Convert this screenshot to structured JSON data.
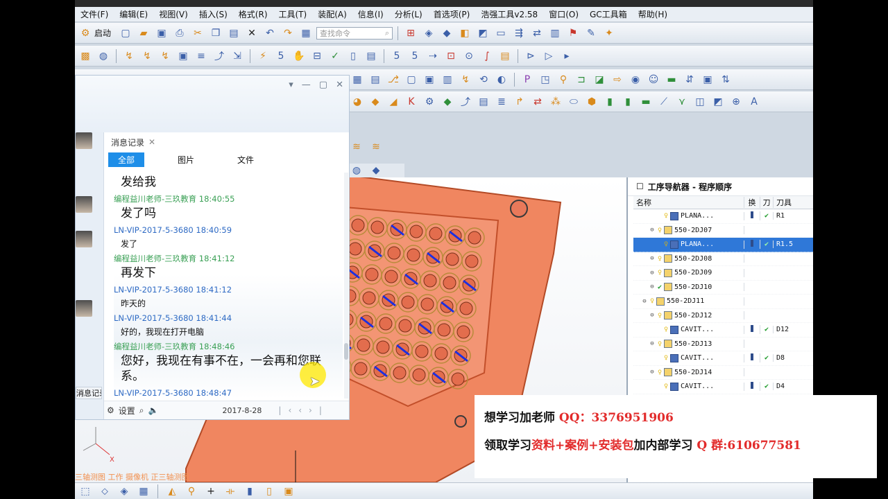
{
  "app": {
    "menu": [
      "文件(F)",
      "编辑(E)",
      "视图(V)",
      "插入(S)",
      "格式(R)",
      "工具(T)",
      "装配(A)",
      "信息(I)",
      "分析(L)",
      "首选项(P)",
      "浩强工具v2.58",
      "窗口(O)",
      "GC工具箱",
      "帮助(H)"
    ],
    "start_label": "启动",
    "search_placeholder": "查找命令",
    "bottom_hints": "三轴测图 工作 摄像机 正三轴测图"
  },
  "chat": {
    "history_tab": "消息记录",
    "tabs": [
      "全部",
      "图片",
      "文件"
    ],
    "side_label": "消息记录",
    "messages": [
      {
        "type": "big",
        "text": "发给我"
      },
      {
        "type": "meta",
        "who": "teacher",
        "text": "编程益川老师-三玖教育 18:40:55"
      },
      {
        "type": "big",
        "text": "发了吗"
      },
      {
        "type": "meta",
        "who": "student",
        "text": "LN-VIP-2017-5-3680 18:40:59"
      },
      {
        "type": "small",
        "text": "发了"
      },
      {
        "type": "meta",
        "who": "teacher",
        "text": "编程益川老师-三玖教育 18:41:12"
      },
      {
        "type": "big",
        "text": "再发下"
      },
      {
        "type": "meta",
        "who": "student",
        "text": "LN-VIP-2017-5-3680 18:41:12"
      },
      {
        "type": "small",
        "text": "昨天的"
      },
      {
        "type": "meta",
        "who": "student",
        "text": "LN-VIP-2017-5-3680 18:41:44"
      },
      {
        "type": "small",
        "text": "好的，我现在打开电脑"
      },
      {
        "type": "meta",
        "who": "teacher",
        "text": "编程益川老师-三玖教育 18:48:46"
      },
      {
        "type": "big",
        "text": "您好，我现在有事不在，一会再和您联系。"
      },
      {
        "type": "meta",
        "who": "student",
        "text": "LN-VIP-2017-5-3680 18:48:47"
      }
    ],
    "footer": {
      "settings": "设置",
      "date": "2017-8-28"
    }
  },
  "navigator": {
    "title": "工序导航器 - 程序顺序",
    "columns": [
      "名称",
      "换",
      "刀",
      "刀具"
    ],
    "rows": [
      {
        "indent": 4,
        "name": "PLANA...",
        "kind": "op",
        "status": "key",
        "check": true,
        "tool": "R1",
        "selected": false
      },
      {
        "indent": 2,
        "name": "550-2DJ07",
        "kind": "group",
        "status": "key",
        "check": false,
        "tool": "",
        "selected": false
      },
      {
        "indent": 4,
        "name": "PLANA...",
        "kind": "op",
        "status": "key",
        "check": true,
        "tool": "R1.5",
        "selected": true
      },
      {
        "indent": 2,
        "name": "550-2DJ08",
        "kind": "group",
        "status": "key",
        "check": false,
        "tool": "",
        "selected": false
      },
      {
        "indent": 2,
        "name": "550-2DJ09",
        "kind": "group",
        "status": "key",
        "check": false,
        "tool": "",
        "selected": false
      },
      {
        "indent": 2,
        "name": "550-2DJ10",
        "kind": "group",
        "status": "check",
        "check": false,
        "tool": "",
        "selected": false
      },
      {
        "indent": 1,
        "name": "550-2DJ11",
        "kind": "group",
        "status": "key",
        "check": false,
        "tool": "",
        "selected": false
      },
      {
        "indent": 2,
        "name": "550-2DJ12",
        "kind": "group",
        "status": "key",
        "check": false,
        "tool": "",
        "selected": false
      },
      {
        "indent": 4,
        "name": "CAVIT...",
        "kind": "op",
        "status": "key",
        "check": true,
        "tool": "D12",
        "selected": false
      },
      {
        "indent": 2,
        "name": "550-2DJ13",
        "kind": "group",
        "status": "key",
        "check": false,
        "tool": "",
        "selected": false
      },
      {
        "indent": 4,
        "name": "CAVIT...",
        "kind": "op",
        "status": "key",
        "check": true,
        "tool": "D8",
        "selected": false
      },
      {
        "indent": 2,
        "name": "550-2DJ14",
        "kind": "group",
        "status": "key",
        "check": false,
        "tool": "",
        "selected": false
      },
      {
        "indent": 4,
        "name": "CAVIT...",
        "kind": "op",
        "status": "key",
        "check": true,
        "tool": "D4",
        "selected": false
      }
    ]
  },
  "ad": {
    "line1_a": "想学习加老师 ",
    "line1_b": "QQ：3376951906",
    "line2_a": "领取学习",
    "line2_b": "资料+案例+安装包",
    "line2_c": "加内部学习 ",
    "line2_d": "Q 群:610677581"
  },
  "colors": {
    "part": "#f08660",
    "accent": "#1e8ee8",
    "teacher_meta": "#3aa055",
    "student_meta": "#2e6ac4"
  }
}
